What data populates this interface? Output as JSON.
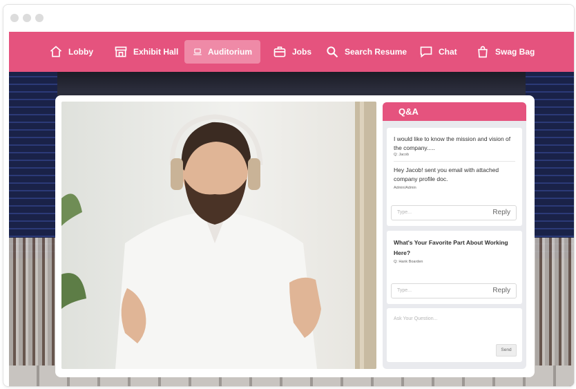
{
  "nav": {
    "items": [
      {
        "label": "Lobby",
        "icon": "home-icon"
      },
      {
        "label": "Exhibit Hall",
        "icon": "store-icon"
      },
      {
        "label": "Auditorium",
        "icon": "laptop-icon"
      },
      {
        "label": "Jobs",
        "icon": "briefcase-icon"
      },
      {
        "label": "Search Resume",
        "icon": "search-icon"
      },
      {
        "label": "Chat",
        "icon": "chat-icon"
      },
      {
        "label": "Swag Bag",
        "icon": "bag-icon"
      }
    ],
    "active_index": 2
  },
  "qa": {
    "title": "Q&A",
    "threads": [
      {
        "question": "I would like to know the mission and vision of the company.....",
        "asker": "Q: Jacob",
        "answer": "Hey Jacob! sent you email with attached company profile doc.",
        "answerer": "Admin/Admin",
        "reply_placeholder": "Type...",
        "reply_label": "Reply"
      },
      {
        "question": "What's Your Favorite Part About Working Here?",
        "asker": "Q: Hank Boarden",
        "reply_placeholder": "Type...",
        "reply_label": "Reply"
      }
    ],
    "ask_placeholder": "Ask Your Question...",
    "send_label": "Send"
  },
  "colors": {
    "brand": "#e5537e",
    "nav_active": "#ef8aa7",
    "qa_background": "#e9eaee"
  }
}
